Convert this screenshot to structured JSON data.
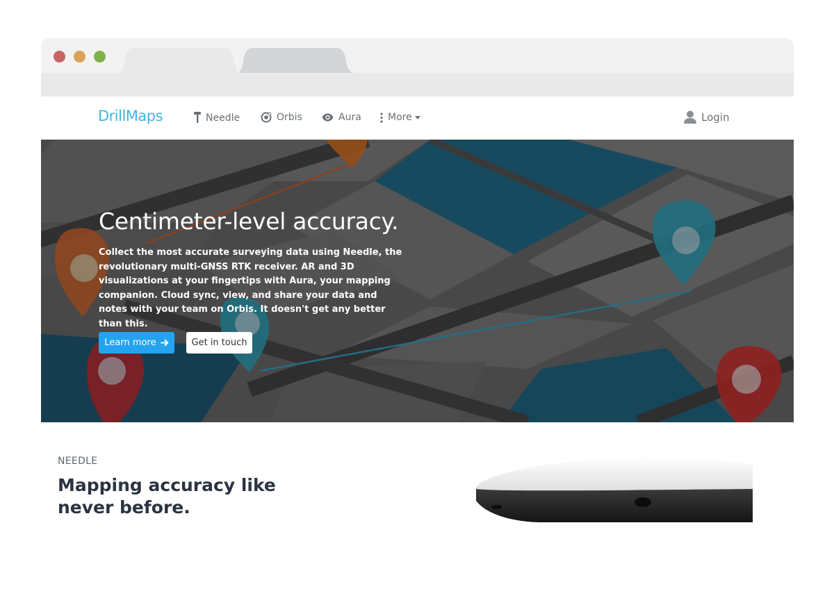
{
  "brand": {
    "logo": "DrillMaps",
    "logo_color": "#3fb6e0"
  },
  "nav": {
    "items": [
      {
        "label": "Needle",
        "icon": "needle-icon"
      },
      {
        "label": "Orbis",
        "icon": "orbis-icon"
      },
      {
        "label": "Aura",
        "icon": "eye-icon"
      },
      {
        "label": "More",
        "icon": "vertical-dots-icon"
      }
    ],
    "login": {
      "label": "Login",
      "icon": "user-icon"
    }
  },
  "hero": {
    "title": "Centimeter-level accuracy.",
    "text": "Collect the most accurate surveying data using Needle, the revolutionary multi-GNSS RTK receiver. AR and 3D visualizations at your fingertips with Aura, your mapping companion. Cloud sync, view, and share your data and notes with your team on Orbis. It doesn't get any better than this.",
    "primary_button": "Learn more",
    "secondary_button": "Get in touch",
    "accent_color": "#24a3f0"
  },
  "section": {
    "label": "NEEDLE",
    "title": "Mapping accuracy like never before."
  }
}
